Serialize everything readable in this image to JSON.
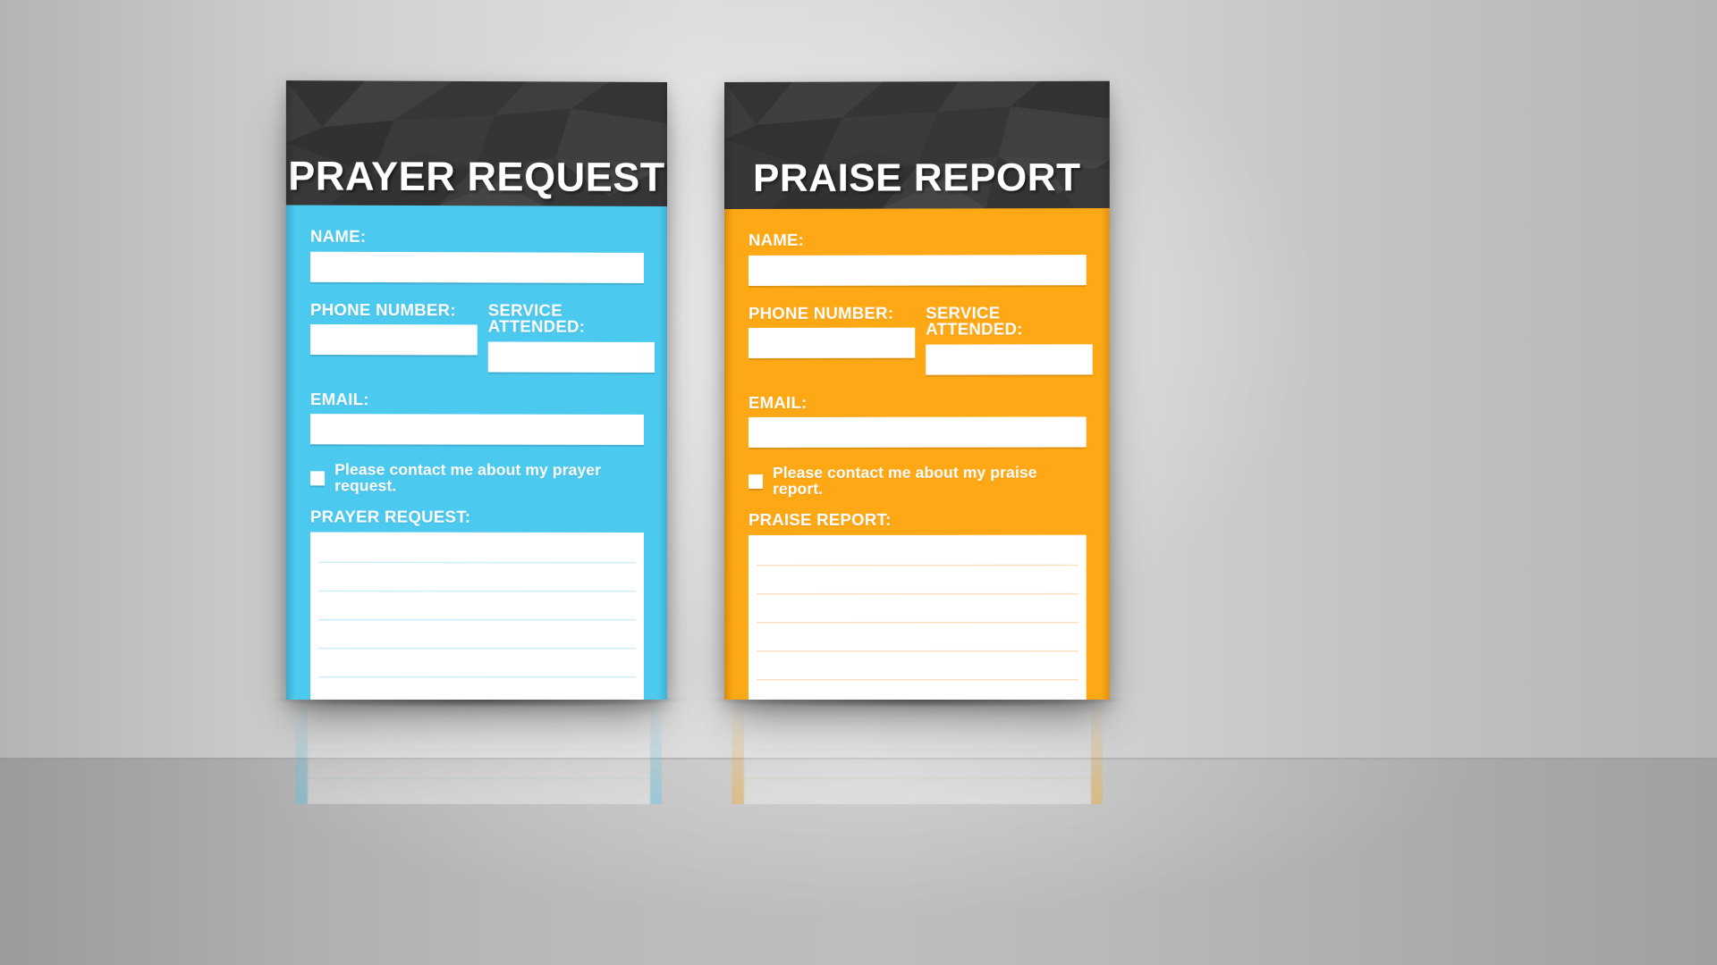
{
  "scene": {
    "background_wall_color": "#d6d6d6",
    "background_floor_color": "#b5b5b5"
  },
  "cards": [
    {
      "id": "prayer-request",
      "title": "PRAYER REQUEST",
      "accent_color": "#4CC9EF",
      "header_color": "#383838",
      "rule_line_color": "#CFEEFB",
      "fields": {
        "name_label": "NAME:",
        "name_value": "",
        "phone_label": "PHONE NUMBER:",
        "phone_value": "",
        "service_label": "SERVICE ATTENDED:",
        "service_value": "",
        "email_label": "EMAIL:",
        "email_value": "",
        "consent_text": "Please contact me about my prayer request.",
        "consent_checked": false,
        "message_label": "PRAYER REQUEST:",
        "message_value": "",
        "message_line_count": 7
      }
    },
    {
      "id": "praise-report",
      "title": "PRAISE REPORT",
      "accent_color": "#FFA815",
      "header_color": "#383838",
      "rule_line_color": "#FBE0C2",
      "fields": {
        "name_label": "NAME:",
        "name_value": "",
        "phone_label": "PHONE NUMBER:",
        "phone_value": "",
        "service_label": "SERVICE ATTENDED:",
        "service_value": "",
        "email_label": "EMAIL:",
        "email_value": "",
        "consent_text": "Please contact me about my praise report.",
        "consent_checked": false,
        "message_label": "PRAISE REPORT:",
        "message_value": "",
        "message_line_count": 7
      }
    }
  ]
}
